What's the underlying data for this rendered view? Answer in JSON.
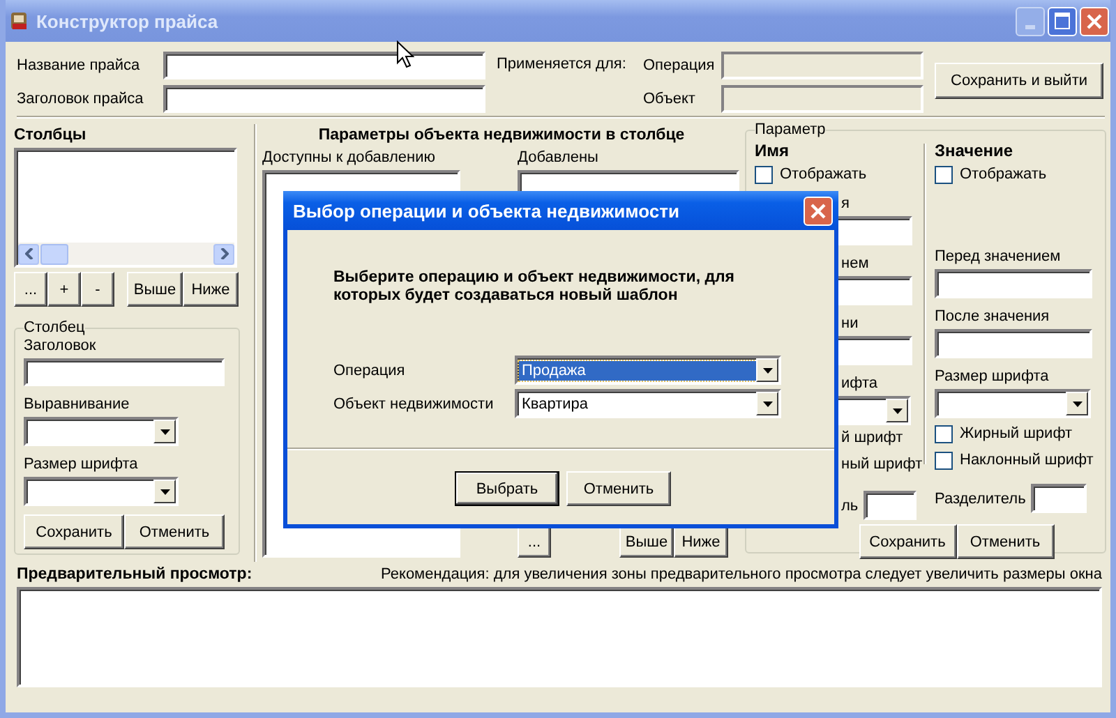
{
  "window": {
    "title": "Конструктор прайса",
    "title_buttons": [
      {
        "kind": "minimize",
        "disabled": true
      },
      {
        "kind": "maximize",
        "disabled": false
      },
      {
        "kind": "close",
        "disabled": false
      }
    ]
  },
  "header": {
    "fields": [
      {
        "label": "Название прайса"
      },
      {
        "label": "Заголовок прайса"
      }
    ],
    "applies_to": {
      "label": "Применяется для:",
      "fields": [
        {
          "label": "Операция"
        },
        {
          "label": "Объект"
        }
      ]
    },
    "save_exit_button": "Сохранить и выйти"
  },
  "columns_panel": {
    "title": "Столбцы",
    "buttons_left": [
      "...",
      "+",
      "-"
    ],
    "buttons_right": [
      "Выше",
      "Ниже"
    ]
  },
  "column_group": {
    "title": "Столбец",
    "fields": [
      {
        "kind": "text",
        "label": "Заголовок"
      },
      {
        "kind": "combo",
        "label": "Выравнивание"
      },
      {
        "kind": "combo",
        "label": "Размер шрифта"
      }
    ],
    "buttons": [
      "Сохранить",
      "Отменить"
    ]
  },
  "object_params": {
    "title": "Параметры объекта недвижимости в столбце",
    "available_label": "Доступны к добавлению",
    "added_label": "Добавлены",
    "buttons_left": [
      "..."
    ],
    "buttons_right": [
      "Выше",
      "Ниже"
    ]
  },
  "parameter_group": {
    "title": "Параметр",
    "name_column": {
      "heading": "Имя",
      "rows": [
        {
          "kind": "checkbox",
          "label": "Отображать",
          "checked": false
        },
        {
          "kind": "text",
          "label": "я"
        },
        {
          "kind": "text",
          "label": "нем"
        },
        {
          "kind": "text",
          "label": "ни"
        },
        {
          "kind": "combo",
          "label": "ифта"
        },
        {
          "kind": "label",
          "label": "й шрифт"
        },
        {
          "kind": "label",
          "label": "ный шрифт"
        },
        {
          "kind": "inline",
          "label": "ль"
        }
      ]
    },
    "value_column": {
      "heading": "Значение",
      "rows": [
        {
          "kind": "checkbox",
          "label": "Отображать",
          "checked": false
        },
        {
          "kind": "text",
          "label": "Перед значением"
        },
        {
          "kind": "text",
          "label": "После значения"
        },
        {
          "kind": "combo",
          "label": "Размер шрифта"
        },
        {
          "kind": "checkbox",
          "label": "Жирный шрифт",
          "checked": false
        },
        {
          "kind": "checkbox",
          "label": "Наклонный шрифт",
          "checked": false
        },
        {
          "kind": "inline",
          "label": "Разделитель"
        }
      ]
    },
    "buttons": [
      "Сохранить",
      "Отменить"
    ]
  },
  "preview": {
    "title": "Предварительный просмотр:",
    "hint": "Рекомендация: для увеличения зоны предварительного просмотра следует увеличить размеры окна"
  },
  "dialog": {
    "title": "Выбор операции и объекта недвижимости",
    "prompt": "Выберите операцию и объект недвижимости, для которых будет создаваться новый шаблон",
    "fields": [
      {
        "label": "Операция",
        "value": "Продажа",
        "selected": true
      },
      {
        "label": "Объект недвижимости",
        "value": "Квартира",
        "selected": false
      }
    ],
    "buttons": [
      {
        "label": "Выбрать",
        "default": true
      },
      {
        "label": "Отменить",
        "default": false
      }
    ]
  }
}
